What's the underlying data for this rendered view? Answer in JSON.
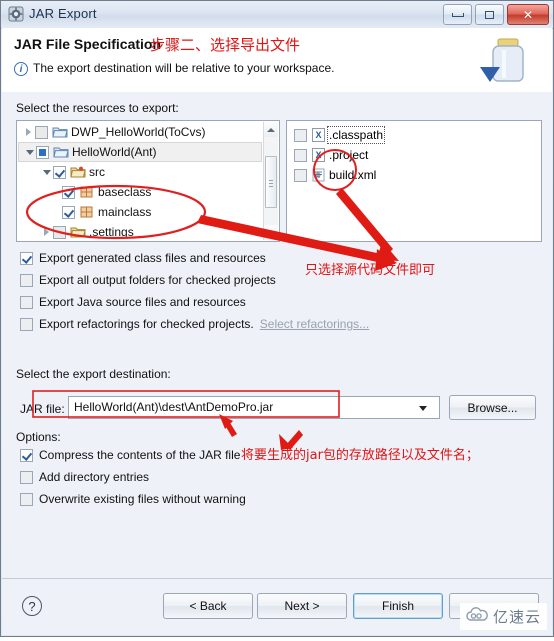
{
  "window": {
    "title": "JAR Export",
    "icon": "jar-export-icon",
    "controls": {
      "minimize": "minimize-button",
      "maximize": "maximize-button",
      "close": "✕"
    }
  },
  "header": {
    "title": "JAR File Specification",
    "annotation": "步骤二、选择导出文件",
    "info_icon": "i",
    "info_text": "The export destination will be relative to your workspace.",
    "image": "jar-bottle-icon"
  },
  "resources": {
    "label": "Select the resources to export:",
    "tree": [
      {
        "name": "DWP_HelloWorld(ToCvs)",
        "indent": 0,
        "twisty": "right",
        "check": "empty",
        "icon": "folder-closed-icon",
        "selected": false
      },
      {
        "name": "HelloWorld(Ant)",
        "indent": 0,
        "twisty": "down",
        "check": "partial",
        "icon": "folder-open-icon",
        "selected": true
      },
      {
        "name": "src",
        "indent": 1,
        "twisty": "down",
        "check": "checked",
        "icon": "source-folder-icon",
        "selected": false
      },
      {
        "name": "baseclass",
        "indent": 2,
        "twisty": "none",
        "check": "checked",
        "icon": "package-icon",
        "selected": false
      },
      {
        "name": "mainclass",
        "indent": 2,
        "twisty": "none",
        "check": "checked",
        "icon": "package-icon",
        "selected": false
      },
      {
        "name": ".settings",
        "indent": 1,
        "twisty": "right",
        "check": "empty",
        "icon": "folder-closed-icon",
        "selected": false
      }
    ],
    "files": [
      {
        "name": ".classpath",
        "icon": "xml-file-icon",
        "checked": false,
        "focused": true
      },
      {
        "name": ".project",
        "icon": "xml-file-icon",
        "checked": false,
        "focused": false
      },
      {
        "name": "build.xml",
        "icon": "ant-file-icon",
        "checked": false,
        "focused": false
      }
    ]
  },
  "export_options": [
    {
      "label": "Export generated class files and resources",
      "checked": true
    },
    {
      "label": "Export all output folders for checked projects",
      "checked": false
    },
    {
      "label": "Export Java source files and resources",
      "checked": false
    },
    {
      "label": "Export refactorings for checked projects.",
      "checked": false,
      "link": "Select refactorings..."
    }
  ],
  "destination": {
    "label": "Select the export destination:",
    "field_label": "JAR file:",
    "value": "HelloWorld(Ant)\\dest\\AntDemoPro.jar",
    "placeholder": "",
    "dropdown_icon": "chevron-down-icon",
    "browse_label": "Browse..."
  },
  "options": {
    "label": "Options:",
    "items": [
      {
        "label": "Compress the contents of the JAR file",
        "checked": true
      },
      {
        "label": "Add directory entries",
        "checked": false
      },
      {
        "label": "Overwrite existing files without warning",
        "checked": false
      }
    ]
  },
  "footer": {
    "help_icon": "?",
    "back_label": "< Back",
    "next_label": "Next >",
    "finish_label": "Finish"
  },
  "annotations": {
    "files_note": "只选择源代码文件即可",
    "jar_note": "将要生成的jar包的存放路径以及文件名；"
  },
  "watermark": {
    "text": "亿速云",
    "icon": "cloud-logo-icon"
  },
  "colors": {
    "annotation_red": "#e11414",
    "accent_blue": "#2d6fc4",
    "close_red": "#c43c2c"
  }
}
